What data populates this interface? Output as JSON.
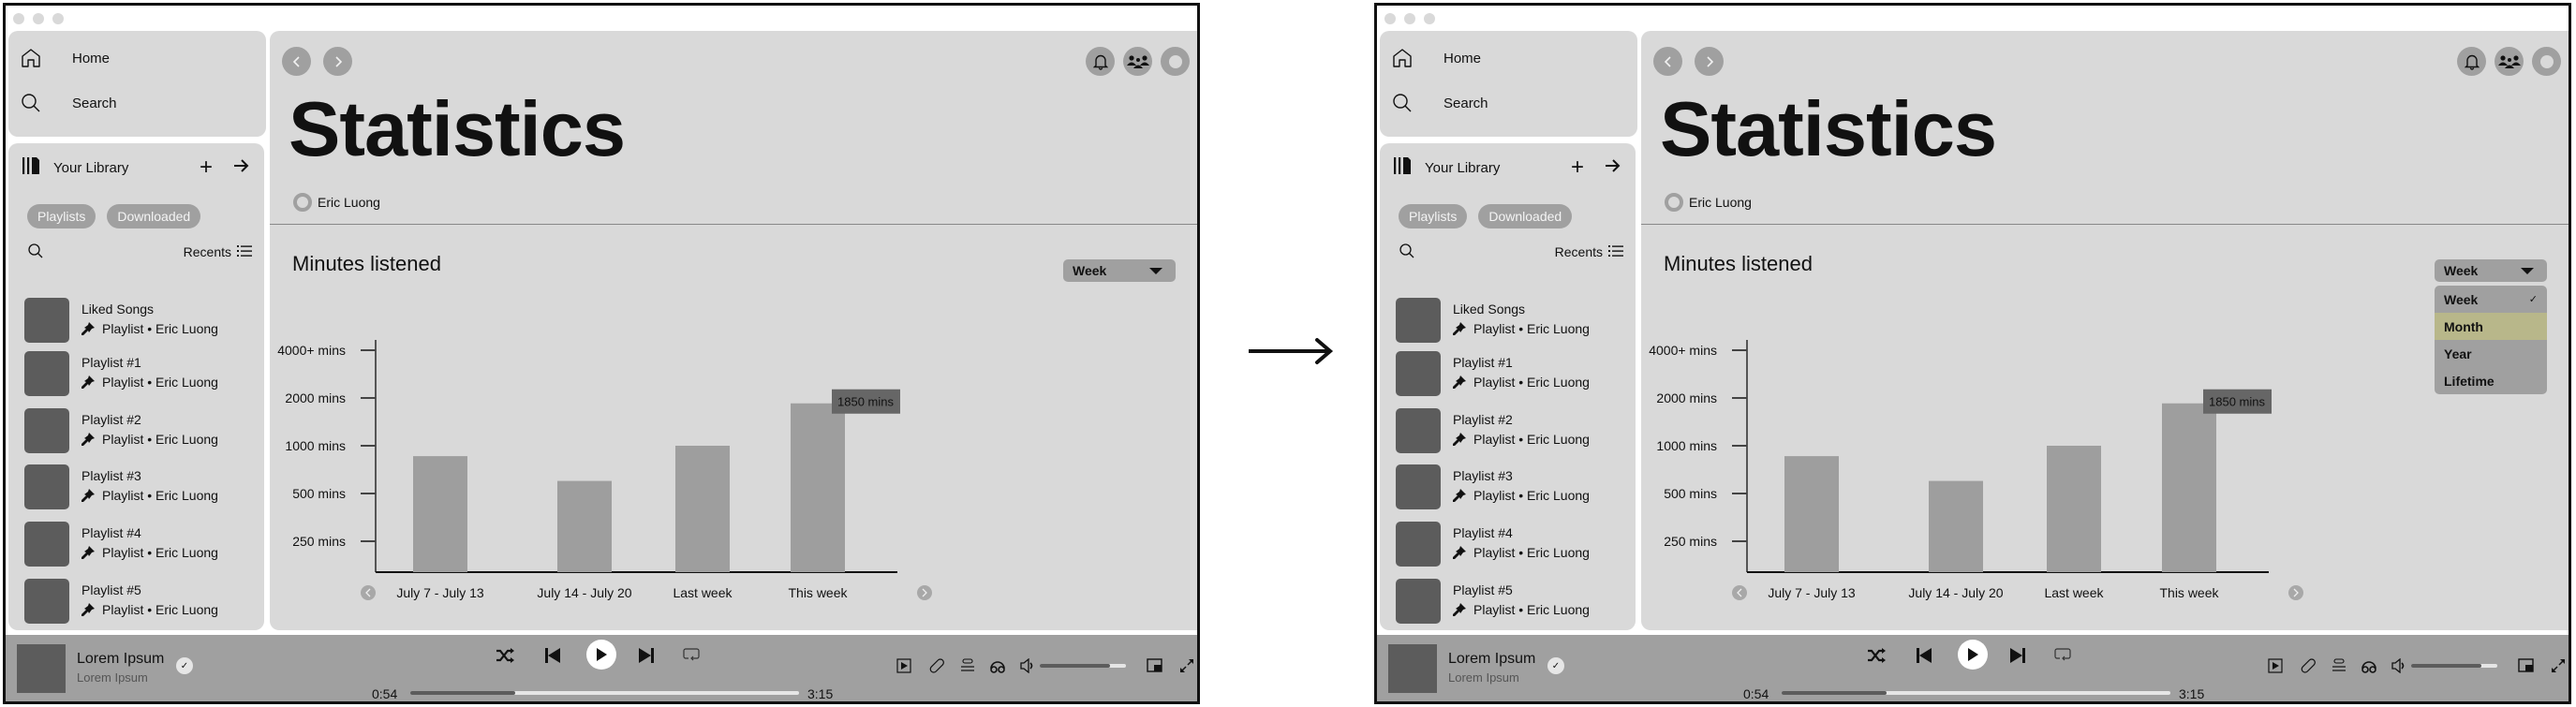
{
  "window": {
    "traffic_lights": [
      "close",
      "minimize",
      "maximize"
    ]
  },
  "sidebar": {
    "nav": [
      {
        "label": "Home",
        "icon": "home-icon"
      },
      {
        "label": "Search",
        "icon": "search-icon"
      }
    ],
    "library": {
      "title": "Your Library",
      "add_icon": "plus-icon",
      "expand_icon": "arrow-right-icon",
      "chips": [
        "Playlists",
        "Downloaded"
      ],
      "sort_label": "Recents",
      "items": [
        {
          "title": "Liked Songs",
          "subtitle": "Playlist • Eric Luong",
          "pinned": true
        },
        {
          "title": "Playlist #1",
          "subtitle": "Playlist • Eric Luong",
          "pinned": true
        },
        {
          "title": "Playlist #2",
          "subtitle": "Playlist • Eric Luong",
          "pinned": true
        },
        {
          "title": "Playlist #3",
          "subtitle": "Playlist • Eric Luong",
          "pinned": true
        },
        {
          "title": "Playlist #4",
          "subtitle": "Playlist • Eric Luong",
          "pinned": true
        },
        {
          "title": "Playlist #5",
          "subtitle": "Playlist • Eric Luong",
          "pinned": true
        }
      ]
    }
  },
  "header": {
    "back_icon": "chevron-left-icon",
    "forward_icon": "chevron-right-icon",
    "right_icons": [
      "bell-icon",
      "friends-icon",
      "profile-icon"
    ]
  },
  "page": {
    "title": "Statistics",
    "owner": "Eric Luong",
    "section_title": "Minutes listened",
    "range_select": {
      "selected": "Week",
      "options": [
        "Week",
        "Month",
        "Year",
        "Lifetime"
      ],
      "hovered": "Month"
    }
  },
  "chart_data": {
    "type": "bar",
    "title": "Minutes listened",
    "xlabel": "",
    "ylabel": "",
    "scale": "log2",
    "categories": [
      "July 7 - July 13",
      "July 14 - July 20",
      "Last week",
      "This week"
    ],
    "values": [
      860,
      600,
      1000,
      1850
    ],
    "ytick_values": [
      4000,
      2000,
      1000,
      500,
      250
    ],
    "ytick_labels": [
      "4000+ mins",
      "2000 mins",
      "1000 mins",
      "500 mins",
      "250 mins"
    ],
    "ylim": [
      150,
      5000
    ],
    "highlight": {
      "category": "This week",
      "label": "1850 mins"
    },
    "grid": false,
    "legend": "none"
  },
  "player": {
    "track_title": "Lorem Ipsum",
    "track_artist": "Lorem Ipsum",
    "elapsed": "0:54",
    "duration": "3:15",
    "progress": 0.27,
    "volume": 0.82,
    "controls": [
      "shuffle-icon",
      "previous-icon",
      "play-icon",
      "next-icon",
      "repeat-icon"
    ],
    "right_controls": [
      "now-playing-view-icon",
      "lyrics-icon",
      "queue-icon",
      "connect-device-icon",
      "volume-icon",
      "miniplayer-icon",
      "fullscreen-icon"
    ],
    "colors": {
      "bar_bg": "#a0a0a0",
      "panel_bg": "#d9d9d9",
      "highlight_option": "#b8b78a"
    }
  },
  "transition": {
    "arrow_icon": "arrow-right-icon"
  }
}
